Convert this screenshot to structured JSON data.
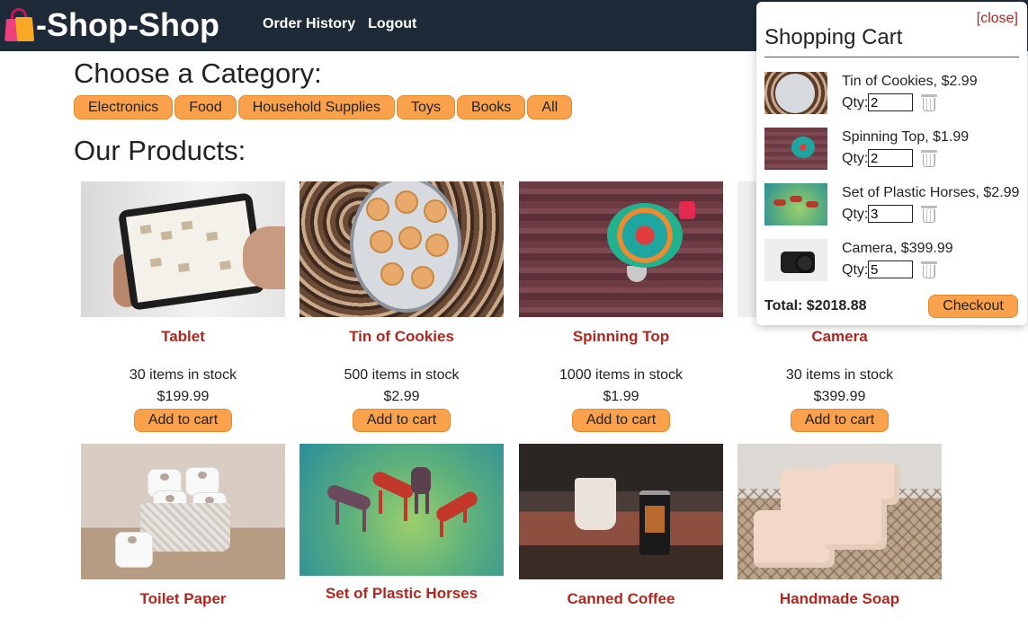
{
  "header": {
    "brand": "-Shop-Shop",
    "nav": [
      "Order History",
      "Logout"
    ]
  },
  "categories": {
    "title": "Choose a Category:",
    "items": [
      "Electronics",
      "Food",
      "Household Supplies",
      "Toys",
      "Books",
      "All"
    ]
  },
  "products_section": {
    "title": "Our Products:",
    "add_label": "Add to cart",
    "items": [
      {
        "name": "Tablet",
        "stock": "30 items in stock",
        "price": "$199.99"
      },
      {
        "name": "Tin of Cookies",
        "stock": "500 items in stock",
        "price": "$2.99"
      },
      {
        "name": "Spinning Top",
        "stock": "1000 items in stock",
        "price": "$1.99"
      },
      {
        "name": "Camera",
        "stock": "30 items in stock",
        "price": "$399.99"
      },
      {
        "name": "Toilet Paper"
      },
      {
        "name": "Set of Plastic Horses"
      },
      {
        "name": "Canned Coffee"
      },
      {
        "name": "Handmade Soap"
      }
    ]
  },
  "cart": {
    "close_label": "[close]",
    "title": "Shopping Cart",
    "qty_label": "Qty:",
    "items": [
      {
        "title": "Tin of Cookies, $2.99",
        "qty": "2"
      },
      {
        "title": "Spinning Top, $1.99",
        "qty": "2"
      },
      {
        "title": "Set of Plastic Horses, $2.99",
        "qty": "3"
      },
      {
        "title": "Camera, $399.99",
        "qty": "5"
      }
    ],
    "total": "Total: $2018.88",
    "checkout_label": "Checkout"
  },
  "colors": {
    "navbar": "#1e2a38",
    "accent_button": "#f9a24b",
    "product_name": "#b3261e"
  }
}
